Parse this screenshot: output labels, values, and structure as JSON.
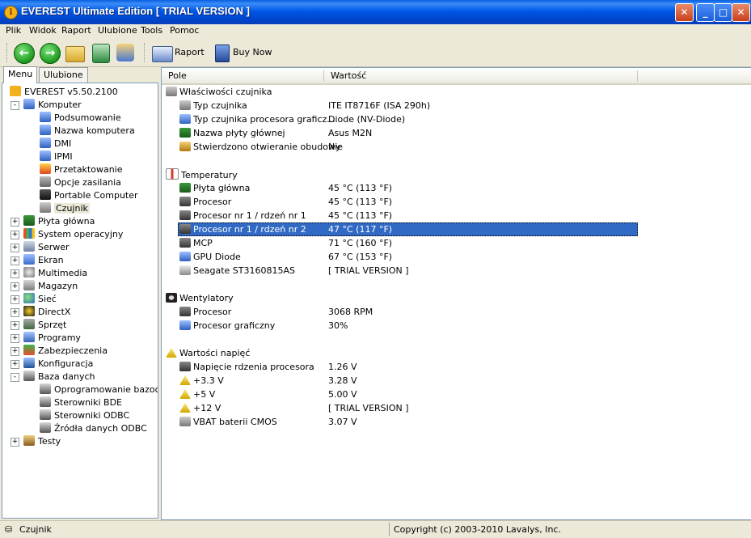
{
  "window": {
    "title": "EVEREST Ultimate Edition  [ TRIAL VERSION ]",
    "buttons": {
      "close": "✕",
      "minimize": "_",
      "maximize": "□",
      "exit": "✕"
    }
  },
  "menu": [
    "Plik",
    "Widok",
    "Raport",
    "Ulubione",
    "Tools",
    "Pomoc"
  ],
  "toolbar": {
    "icons": [
      "back-icon",
      "forward-icon",
      "folder-up-icon",
      "refresh-icon",
      "users-icon",
      "report-icon",
      "buy-icon"
    ],
    "report_label": "Raport",
    "buy_label": "Buy Now"
  },
  "left_tabs": [
    "Menu",
    "Ulubione"
  ],
  "tree": [
    {
      "label": "EVEREST v5.50.2100",
      "icon": "c-info",
      "level": 0,
      "expander": ""
    },
    {
      "label": "Komputer",
      "icon": "c-pc",
      "level": 1,
      "expander": "-"
    },
    {
      "label": "Podsumowanie",
      "icon": "c-pc",
      "level": 2,
      "expander": ""
    },
    {
      "label": "Nazwa komputera",
      "icon": "c-pc",
      "level": 2,
      "expander": ""
    },
    {
      "label": "DMI",
      "icon": "c-pc",
      "level": 2,
      "expander": ""
    },
    {
      "label": "IPMI",
      "icon": "c-pc",
      "level": 2,
      "expander": ""
    },
    {
      "label": "Przetaktowanie",
      "icon": "c-fire",
      "level": 2,
      "expander": ""
    },
    {
      "label": "Opcje zasilania",
      "icon": "c-power",
      "level": 2,
      "expander": ""
    },
    {
      "label": "Portable Computer",
      "icon": "c-laptop",
      "level": 2,
      "expander": ""
    },
    {
      "label": "Czujnik",
      "icon": "c-sensor",
      "level": 2,
      "expander": "",
      "selected": true
    },
    {
      "label": "Płyta główna",
      "icon": "c-mb",
      "level": 1,
      "expander": "+"
    },
    {
      "label": "System operacyjny",
      "icon": "c-win",
      "level": 1,
      "expander": "+"
    },
    {
      "label": "Serwer",
      "icon": "c-server",
      "level": 1,
      "expander": "+"
    },
    {
      "label": "Ekran",
      "icon": "c-monitor",
      "level": 1,
      "expander": "+"
    },
    {
      "label": "Multimedia",
      "icon": "c-media",
      "level": 1,
      "expander": "+"
    },
    {
      "label": "Magazyn",
      "icon": "c-storage",
      "level": 1,
      "expander": "+"
    },
    {
      "label": "Sieć",
      "icon": "c-net",
      "level": 1,
      "expander": "+"
    },
    {
      "label": "DirectX",
      "icon": "c-dx",
      "level": 1,
      "expander": "+"
    },
    {
      "label": "Sprzęt",
      "icon": "c-hw",
      "level": 1,
      "expander": "+"
    },
    {
      "label": "Programy",
      "icon": "c-prog",
      "level": 1,
      "expander": "+"
    },
    {
      "label": "Zabezpieczenia",
      "icon": "c-shield",
      "level": 1,
      "expander": "+"
    },
    {
      "label": "Konfiguracja",
      "icon": "c-cfg",
      "level": 1,
      "expander": "+"
    },
    {
      "label": "Baza danych",
      "icon": "c-db",
      "level": 1,
      "expander": "-"
    },
    {
      "label": "Oprogramowanie bazodanowe",
      "icon": "c-db",
      "level": 2,
      "expander": ""
    },
    {
      "label": "Sterowniki BDE",
      "icon": "c-db",
      "level": 2,
      "expander": ""
    },
    {
      "label": "Sterowniki ODBC",
      "icon": "c-db",
      "level": 2,
      "expander": ""
    },
    {
      "label": "Źródła danych ODBC",
      "icon": "c-db",
      "level": 2,
      "expander": ""
    },
    {
      "label": "Testy",
      "icon": "c-hour",
      "level": 1,
      "expander": "+"
    }
  ],
  "columns": {
    "field": "Pole",
    "value": "Wartość"
  },
  "rows": [
    {
      "type": "group",
      "label": "Właściwości czujnika",
      "icon": "c-sensor"
    },
    {
      "type": "item",
      "label": "Typ czujnika",
      "value": "ITE IT8716F  (ISA 290h)",
      "icon": "c-sensor"
    },
    {
      "type": "item",
      "label": "Typ czujnika procesora graficz...",
      "value": "Diode  (NV-Diode)",
      "icon": "c-pc"
    },
    {
      "type": "item",
      "label": "Nazwa płyty głównej",
      "value": "Asus M2N",
      "icon": "c-mb"
    },
    {
      "type": "item",
      "label": "Stwierdzono otwieranie obudowy",
      "value": "Nie",
      "icon": "c-lock"
    },
    {
      "type": "gap"
    },
    {
      "type": "group",
      "label": "Temperatury",
      "icon": "c-temp"
    },
    {
      "type": "item",
      "label": "Płyta główna",
      "value": "45 °C  (113 °F)",
      "icon": "c-mb"
    },
    {
      "type": "item",
      "label": "Procesor",
      "value": "45 °C  (113 °F)",
      "icon": "c-chip"
    },
    {
      "type": "item",
      "label": "Procesor nr 1 / rdzeń nr 1",
      "value": "45 °C  (113 °F)",
      "icon": "c-chip"
    },
    {
      "type": "item",
      "label": "Procesor nr 1 / rdzeń nr 2",
      "value": "47 °C  (117 °F)",
      "icon": "c-chip",
      "selected": true
    },
    {
      "type": "item",
      "label": "MCP",
      "value": "71 °C  (160 °F)",
      "icon": "c-chip"
    },
    {
      "type": "item",
      "label": "GPU Diode",
      "value": "67 °C  (153 °F)",
      "icon": "c-pc"
    },
    {
      "type": "item",
      "label": "Seagate ST3160815AS",
      "value": "[ TRIAL VERSION ]",
      "icon": "c-hdd"
    },
    {
      "type": "gap"
    },
    {
      "type": "group",
      "label": "Wentylatory",
      "icon": "c-fan"
    },
    {
      "type": "item",
      "label": "Procesor",
      "value": "3068 RPM",
      "icon": "c-chip"
    },
    {
      "type": "item",
      "label": "Procesor graficzny",
      "value": "30%",
      "icon": "c-pc"
    },
    {
      "type": "gap"
    },
    {
      "type": "group",
      "label": "Wartości napięć",
      "icon": "c-volt"
    },
    {
      "type": "item",
      "label": "Napięcie rdzenia procesora",
      "value": "1.26 V",
      "icon": "c-chip"
    },
    {
      "type": "item",
      "label": "+3.3 V",
      "value": "3.28 V",
      "icon": "c-volt"
    },
    {
      "type": "item",
      "label": "+5 V",
      "value": "5.00 V",
      "icon": "c-volt"
    },
    {
      "type": "item",
      "label": "+12 V",
      "value": "[ TRIAL VERSION ]",
      "icon": "c-volt"
    },
    {
      "type": "item",
      "label": "VBAT baterii CMOS",
      "value": "3.07 V",
      "icon": "c-sensor"
    }
  ],
  "status": {
    "left": "Czujnik",
    "right": "Copyright (c) 2003-2010 Lavalys, Inc."
  }
}
